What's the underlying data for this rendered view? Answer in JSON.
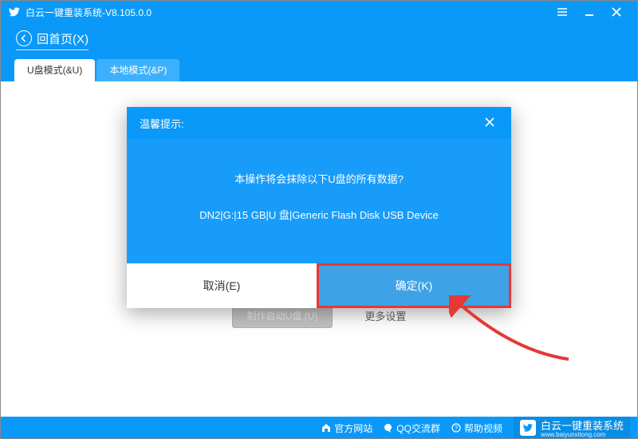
{
  "titlebar": {
    "title": "白云一键重装系统-V8.105.0.0"
  },
  "nav": {
    "back": "回首页(X)"
  },
  "tabs": {
    "usb": "U盘模式(&U)",
    "local": "本地模式(&P)"
  },
  "bg": {
    "makeBtn": "制作启动U盘 (U)",
    "more": "更多设置"
  },
  "dialog": {
    "title": "温馨提示:",
    "line1": "本操作将会抹除以下U盘的所有数据?",
    "line2": "DN2|G:|15 GB|U 盘|Generic Flash Disk USB Device",
    "cancel": "取消(E)",
    "ok": "确定(K)"
  },
  "footer": {
    "site": "官方网站",
    "qq": "QQ交流群",
    "help": "帮助视频",
    "brand": "白云一键重装系统",
    "brandSub": "www.baiyunxitong.com"
  }
}
